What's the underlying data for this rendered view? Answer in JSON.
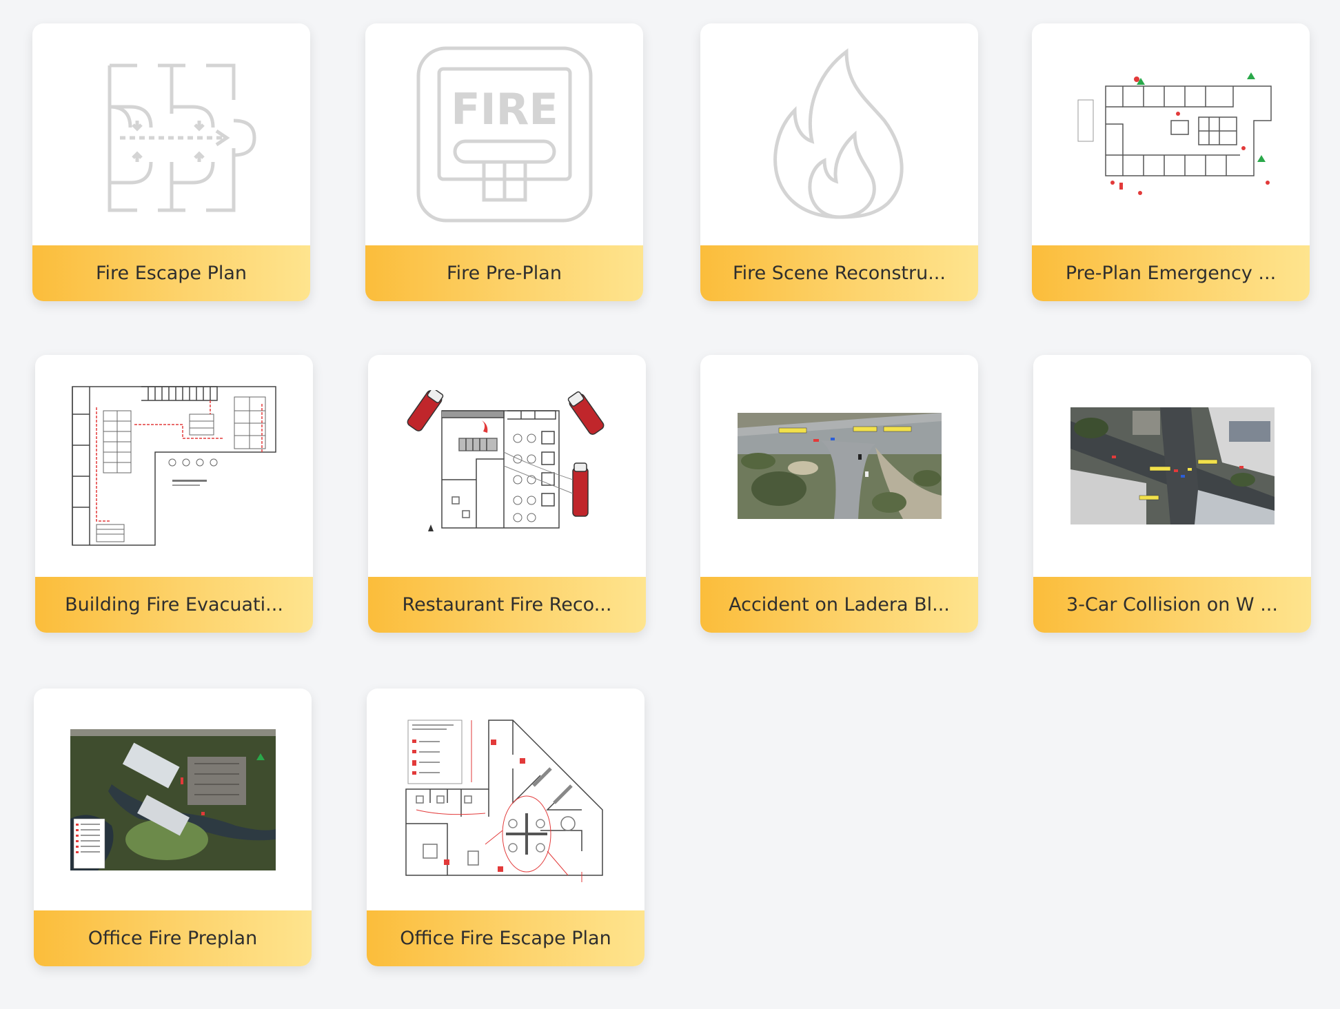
{
  "templates": [
    {
      "title": "Fire Escape Plan",
      "icon": "fire-escape-floorplan-icon"
    },
    {
      "title": "Fire Pre-Plan",
      "icon": "fire-sign-icon",
      "icon_text": "FIRE"
    },
    {
      "title": "Fire Scene Reconstru...",
      "icon": "flame-icon"
    },
    {
      "title": "Pre-Plan Emergency ...",
      "icon": "emergency-floorplan-thumbnail"
    },
    {
      "title": "Building Fire Evacuati...",
      "icon": "building-evacuation-thumbnail"
    },
    {
      "title": "Restaurant Fire Reco...",
      "icon": "restaurant-fire-thumbnail"
    },
    {
      "title": "Accident on Ladera Bl...",
      "icon": "aerial-accident-thumbnail"
    },
    {
      "title": "3-Car Collision on W ...",
      "icon": "aerial-collision-thumbnail"
    },
    {
      "title": "Office Fire Preplan",
      "icon": "aerial-office-thumbnail"
    },
    {
      "title": "Office Fire Escape Plan",
      "icon": "office-escape-floorplan-thumbnail"
    }
  ],
  "colors": {
    "background": "#f4f5f7",
    "caption_start": "#fbbd3b",
    "caption_end": "#fee48e",
    "icon_gray": "#d4d4d4",
    "accent_red": "#e23a3a"
  }
}
